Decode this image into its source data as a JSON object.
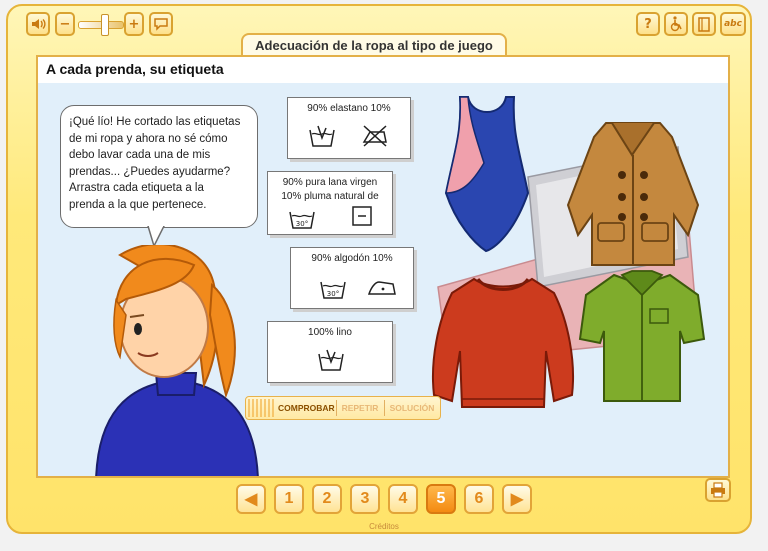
{
  "toolbar": {
    "speaker_icon": "speaker-icon",
    "minus": "−",
    "plus": "+",
    "speech_icon": "speech-bubble-icon",
    "help": "?",
    "accessibility_icon": "wheelchair-icon",
    "notebook_icon": "notebook-icon",
    "glossary": "abc"
  },
  "volume_level": 0.6,
  "title_tab": "Adecuación de la ropa al tipo de juego",
  "stage": {
    "title": "A cada prenda, su etiqueta",
    "bubble_lines": [
      "¡Qué lío! He cortado las etiquetas",
      "de mi ropa y ahora no sé cómo",
      "debo lavar cada una de mis",
      "prendas... ¿Puedes ayudarme?",
      "Arrastra cada etiqueta a la",
      "prenda a la que pertenece."
    ],
    "labels": [
      {
        "line1": "90% elastano 10%",
        "line2": ""
      },
      {
        "line1": "90% pura lana virgen",
        "line2": "10% pluma natural de"
      },
      {
        "line1": "90% algodón 10%",
        "line2": ""
      },
      {
        "line1": "100% lino",
        "line2": ""
      }
    ],
    "care_30": "30°",
    "actions": {
      "check": "COMPROBAR",
      "repeat": "REPETIR",
      "solution": "SOLUCIÓN"
    }
  },
  "pager": {
    "prev": "◀",
    "pages": [
      "1",
      "2",
      "3",
      "4",
      "5",
      "6"
    ],
    "current": "5",
    "next": "▶"
  },
  "footer": {
    "credits": "Créditos"
  },
  "colors": {
    "frame": "#ffe97a",
    "accent": "#f38a12",
    "stage_bg": "#e1effa"
  }
}
